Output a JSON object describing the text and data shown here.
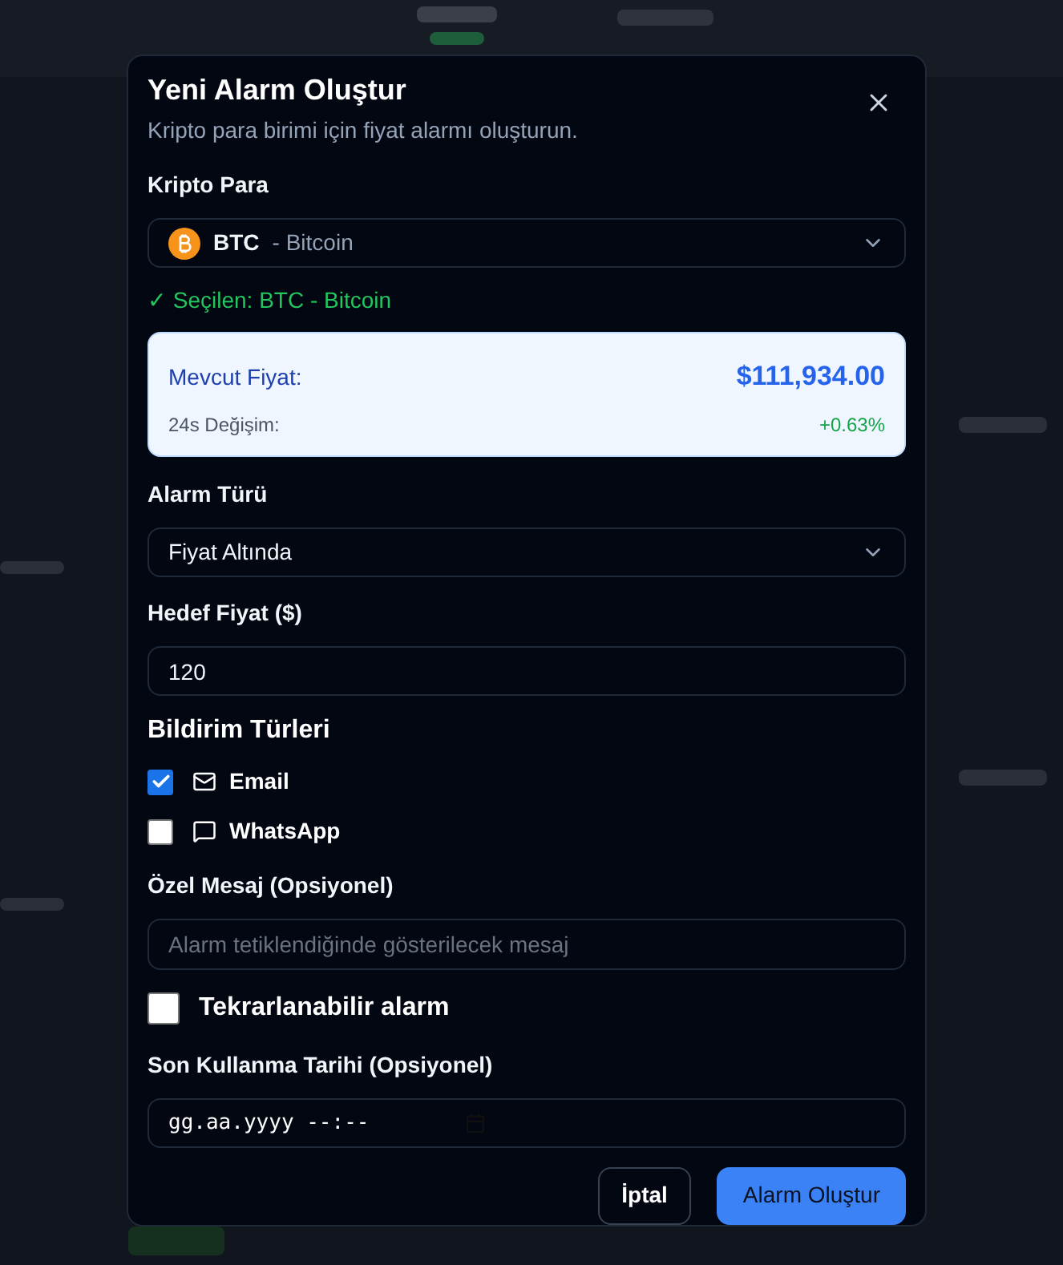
{
  "dialog": {
    "title": "Yeni Alarm Oluştur",
    "subtitle": "Kripto para birimi için fiyat alarmı oluşturun.",
    "crypto": {
      "label": "Kripto Para",
      "symbol": "BTC",
      "name": "- Bitcoin",
      "selected_note": "✓ Seçilen: BTC - Bitcoin"
    },
    "price_card": {
      "current_label": "Mevcut Fiyat:",
      "current_value": "$111,934.00",
      "change_label": "24s Değişim:",
      "change_value": "+0.63%"
    },
    "alarm_type": {
      "label": "Alarm Türü",
      "value": "Fiyat Altında"
    },
    "target_price": {
      "label": "Hedef Fiyat ($)",
      "value": "120"
    },
    "notifications": {
      "title": "Bildirim Türleri",
      "options": [
        {
          "label": "Email",
          "kind": "email",
          "checked": true
        },
        {
          "label": "WhatsApp",
          "kind": "chat",
          "checked": false
        }
      ]
    },
    "custom_message": {
      "label": "Özel Mesaj (Opsiyonel)",
      "placeholder": "Alarm tetiklendiğinde gösterilecek mesaj"
    },
    "repeatable": {
      "label": "Tekrarlanabilir alarm",
      "checked": false
    },
    "expiry": {
      "label": "Son Kullanma Tarihi (Opsiyonel)",
      "placeholder": "gg.aa.yyyy --:--"
    },
    "buttons": [
      {
        "label": "İptal",
        "kind": "secondary"
      },
      {
        "label": "Alarm Oluştur",
        "kind": "primary"
      }
    ]
  }
}
